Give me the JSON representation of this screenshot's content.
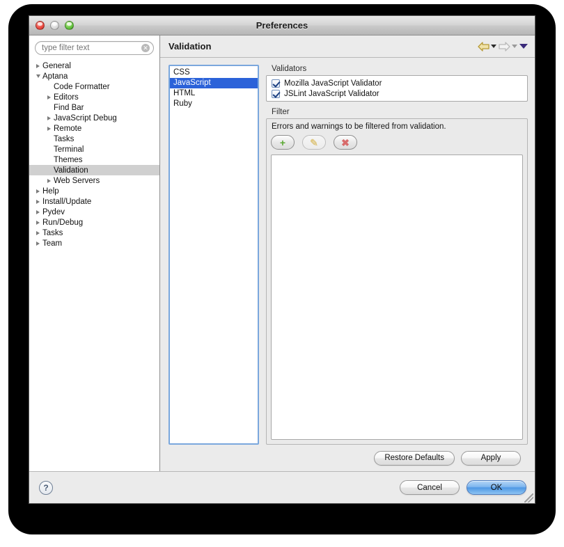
{
  "window": {
    "title": "Preferences",
    "controls": {
      "close": "close-button",
      "minimize": "minimize-button",
      "zoom": "zoom-button"
    }
  },
  "sidebar": {
    "filter": {
      "value": "type filter text",
      "placeholder": "type filter text",
      "clear_glyph": "✕"
    },
    "tree": [
      {
        "label": "General",
        "indent": 0,
        "twisty": "collapsed",
        "selected": false
      },
      {
        "label": "Aptana",
        "indent": 0,
        "twisty": "expanded",
        "selected": false
      },
      {
        "label": "Code Formatter",
        "indent": 1,
        "twisty": "none",
        "selected": false
      },
      {
        "label": "Editors",
        "indent": 1,
        "twisty": "collapsed",
        "selected": false
      },
      {
        "label": "Find Bar",
        "indent": 1,
        "twisty": "none",
        "selected": false
      },
      {
        "label": "JavaScript Debug",
        "indent": 1,
        "twisty": "collapsed",
        "selected": false
      },
      {
        "label": "Remote",
        "indent": 1,
        "twisty": "collapsed",
        "selected": false
      },
      {
        "label": "Tasks",
        "indent": 1,
        "twisty": "none",
        "selected": false
      },
      {
        "label": "Terminal",
        "indent": 1,
        "twisty": "none",
        "selected": false
      },
      {
        "label": "Themes",
        "indent": 1,
        "twisty": "none",
        "selected": false
      },
      {
        "label": "Validation",
        "indent": 1,
        "twisty": "none",
        "selected": true
      },
      {
        "label": "Web Servers",
        "indent": 1,
        "twisty": "collapsed",
        "selected": false
      },
      {
        "label": "Help",
        "indent": 0,
        "twisty": "collapsed",
        "selected": false
      },
      {
        "label": "Install/Update",
        "indent": 0,
        "twisty": "collapsed",
        "selected": false
      },
      {
        "label": "Pydev",
        "indent": 0,
        "twisty": "collapsed",
        "selected": false
      },
      {
        "label": "Run/Debug",
        "indent": 0,
        "twisty": "collapsed",
        "selected": false
      },
      {
        "label": "Tasks",
        "indent": 0,
        "twisty": "collapsed",
        "selected": false
      },
      {
        "label": "Team",
        "indent": 0,
        "twisty": "collapsed",
        "selected": false
      }
    ]
  },
  "main": {
    "page_title": "Validation",
    "nav": {
      "back": "back-arrow-icon",
      "forward": "forward-arrow-icon",
      "menu": "dropdown-menu-icon"
    },
    "languages": [
      {
        "label": "CSS",
        "selected": false
      },
      {
        "label": "JavaScript",
        "selected": true
      },
      {
        "label": "HTML",
        "selected": false
      },
      {
        "label": "Ruby",
        "selected": false
      }
    ],
    "validators": {
      "label": "Validators",
      "items": [
        {
          "label": "Mozilla JavaScript Validator",
          "checked": true
        },
        {
          "label": "JSLint JavaScript Validator",
          "checked": true
        }
      ]
    },
    "filter": {
      "label": "Filter",
      "description": "Errors and warnings to be filtered from validation.",
      "tools": [
        {
          "name": "add-filter-button",
          "glyph": "+",
          "color": "#5aa832",
          "disabled": false
        },
        {
          "name": "edit-filter-button",
          "glyph": "✎",
          "color": "#d6b34a",
          "disabled": true
        },
        {
          "name": "delete-filter-button",
          "glyph": "✖",
          "color": "#d86b6b",
          "disabled": false
        }
      ],
      "entries": []
    },
    "actions": {
      "restore_defaults": "Restore Defaults",
      "apply": "Apply"
    }
  },
  "footer": {
    "help": "?",
    "cancel": "Cancel",
    "ok": "OK"
  }
}
